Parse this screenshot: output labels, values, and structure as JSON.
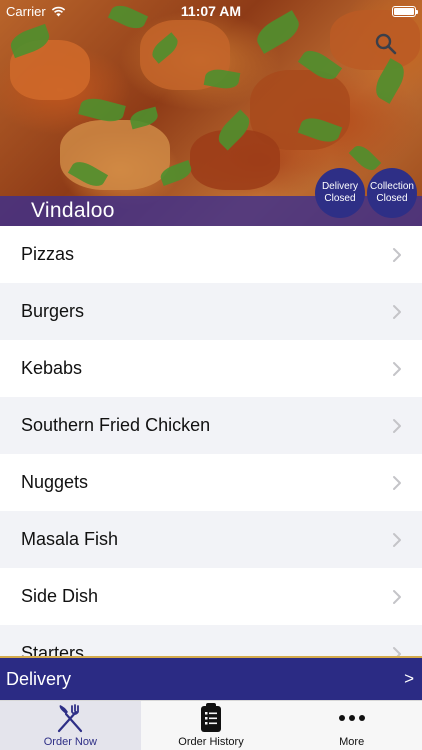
{
  "status_bar": {
    "carrier": "Carrier",
    "time": "11:07 AM",
    "icons": [
      "wifi-icon",
      "battery-icon"
    ]
  },
  "header": {
    "restaurant_name": "Vindaloo",
    "delivery_badge": {
      "line1": "Delivery",
      "line2": "Closed"
    },
    "collection_badge": {
      "line1": "Collection",
      "line2": "Closed"
    },
    "search_icon": "search-icon"
  },
  "categories": [
    {
      "label": "Pizzas"
    },
    {
      "label": "Burgers"
    },
    {
      "label": "Kebabs"
    },
    {
      "label": "Southern Fried Chicken"
    },
    {
      "label": "Nuggets"
    },
    {
      "label": "Masala Fish"
    },
    {
      "label": "Side Dish"
    },
    {
      "label": "Starters"
    }
  ],
  "delivery_bar": {
    "label": "Delivery",
    "arrow": ">"
  },
  "tab_bar": {
    "tabs": [
      {
        "label": "Order Now",
        "icon": "fork-knife-icon",
        "active": true
      },
      {
        "label": "Order History",
        "icon": "clipboard-icon",
        "active": false
      },
      {
        "label": "More",
        "icon": "more-dots-icon",
        "active": false
      }
    ]
  },
  "colors": {
    "brand_navy": "#2b2b84",
    "badge_navy": "#2e2f86",
    "title_band": "#3e308c",
    "accent_gold": "#d4aa4c",
    "row_grey": "#f2f3f7"
  }
}
